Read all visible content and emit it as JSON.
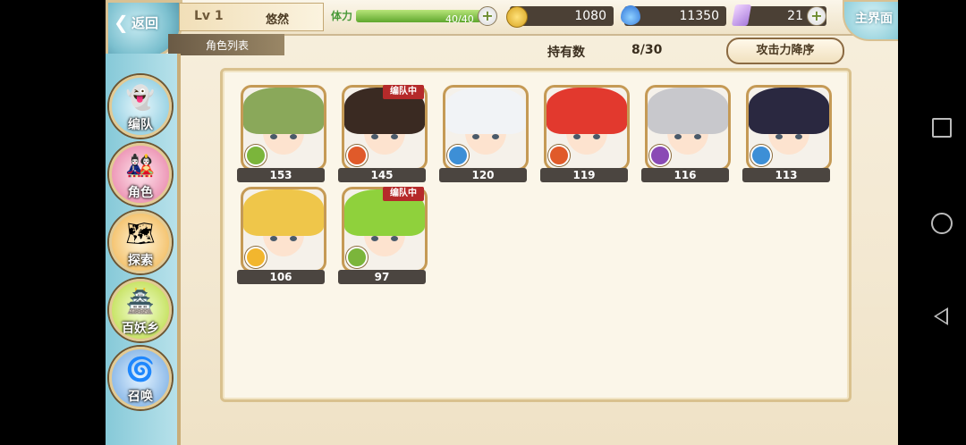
{
  "topbar": {
    "back_label": "返回",
    "level": "Lv 1",
    "player_name": "悠然",
    "stamina_label": "体力",
    "stamina_value": "40/40",
    "stamina_fraction": 1.0,
    "gold": "1080",
    "spirit": "11350",
    "crystal": "21",
    "home_label": "主界面"
  },
  "section": {
    "tab_label": "角色列表",
    "hold_label": "持有数",
    "hold_value": "8/30",
    "sort_label": "攻击力降序"
  },
  "sidenav": {
    "items": [
      {
        "label": "编队",
        "icon": "ghost-icon"
      },
      {
        "label": "角色",
        "icon": "character-icon"
      },
      {
        "label": "探索",
        "icon": "explore-icon"
      },
      {
        "label": "百妖乡",
        "icon": "village-icon"
      },
      {
        "label": "召唤",
        "icon": "summon-icon"
      }
    ]
  },
  "characters": [
    {
      "power": "153",
      "badge": "",
      "hair": "#8aa85a",
      "element": "wind"
    },
    {
      "power": "145",
      "badge": "编队中",
      "hair": "#3a2a22",
      "element": "fire"
    },
    {
      "power": "120",
      "badge": "",
      "hair": "#f1f3f6",
      "element": "water"
    },
    {
      "power": "119",
      "badge": "",
      "hair": "#e2392e",
      "element": "fire"
    },
    {
      "power": "116",
      "badge": "",
      "hair": "#c8c8cc",
      "element": "dark"
    },
    {
      "power": "113",
      "badge": "",
      "hair": "#2a2840",
      "element": "water"
    },
    {
      "power": "106",
      "badge": "",
      "hair": "#efc64a",
      "element": "light"
    },
    {
      "power": "97",
      "badge": "编队中",
      "hair": "#8fd13c",
      "element": "wind"
    }
  ],
  "colors": {
    "wind": "#7bb53b",
    "fire": "#e05a2a",
    "water": "#3d8fd6",
    "dark": "#8a4ab5",
    "light": "#f2b62e"
  }
}
